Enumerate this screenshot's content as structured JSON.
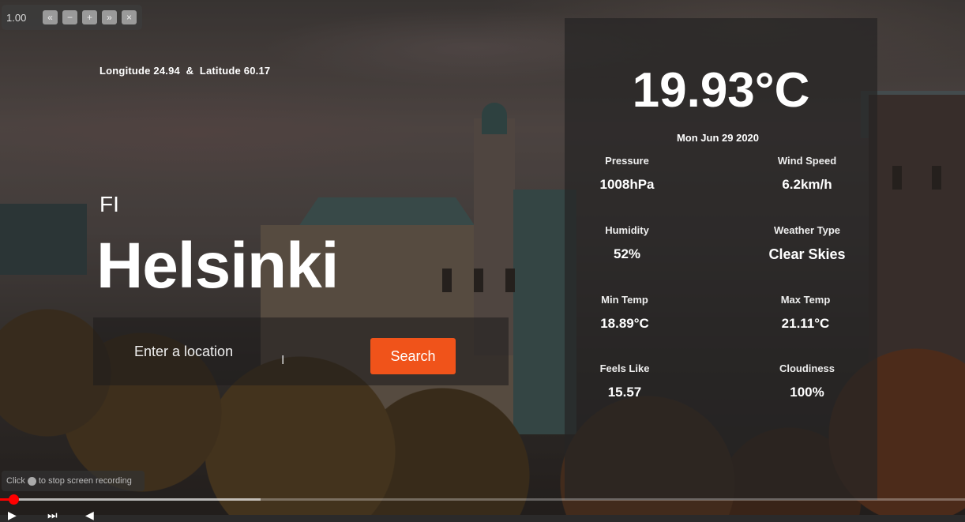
{
  "zoom": {
    "value": "1.00",
    "buttons": [
      "«",
      "−",
      "+",
      "»",
      "×"
    ]
  },
  "location": {
    "longitude_label": "Longitude 24.94",
    "separator": "&",
    "latitude_label": "Latitude 60.17",
    "country": "FI",
    "city": "Helsinki"
  },
  "search": {
    "placeholder": "Enter a location",
    "button_label": "Search"
  },
  "weather": {
    "temperature": "19.93°C",
    "date": "Mon Jun 29 2020",
    "stats": [
      {
        "label": "Pressure",
        "value": "1008hPa"
      },
      {
        "label": "Wind Speed",
        "value": "6.2km/h"
      },
      {
        "label": "Humidity",
        "value": "52%"
      },
      {
        "label": "Weather Type",
        "value": "Clear Skies"
      },
      {
        "label": "Min Temp",
        "value": "18.89°C"
      },
      {
        "label": "Max Temp",
        "value": "21.11°C"
      },
      {
        "label": "Feels Like",
        "value": "15.57"
      },
      {
        "label": "Cloudiness",
        "value": "100%"
      }
    ]
  },
  "recording_hint": {
    "before": "Click",
    "after": "to stop screen recording"
  },
  "video": {
    "played_fraction": 0.014,
    "buffered_fraction": 0.27
  },
  "colors": {
    "accent": "#f0531a",
    "panel": "#262424",
    "progress": "#ff0000"
  }
}
